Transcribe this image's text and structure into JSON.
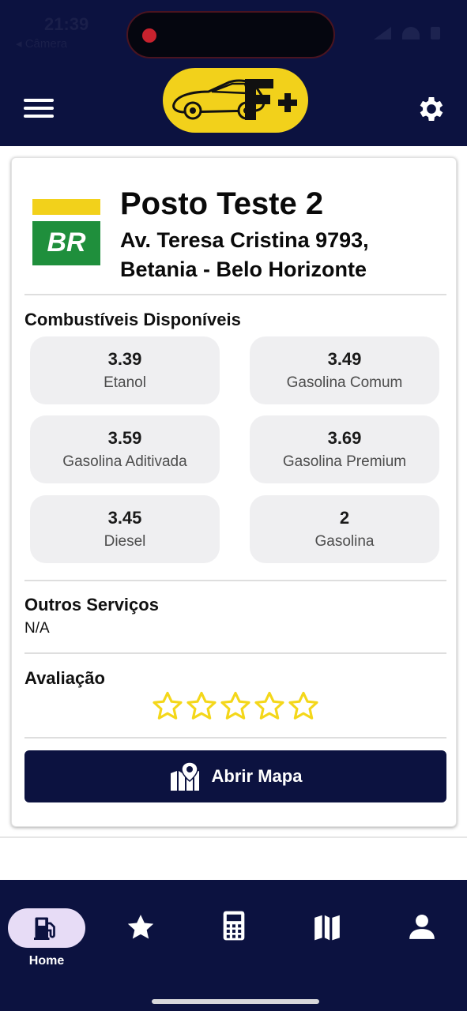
{
  "status_bar": {
    "time": "21:39",
    "back_label": "◂ Câmera"
  },
  "header": {
    "menu_icon": "hamburger-menu-icon",
    "logo_icon": "car-logo",
    "logo_text": "F+",
    "settings_icon": "gear-icon",
    "accent_color": "#f2d11b",
    "bar_color": "#0c1240"
  },
  "station": {
    "brand_logo_text": "BR",
    "name": "Posto Teste 2",
    "address": "Av. Teresa Cristina 9793, Betania - Belo Horizonte"
  },
  "fuels": {
    "title": "Combustíveis Disponíveis",
    "items": [
      {
        "price": "3.39",
        "name": "Etanol"
      },
      {
        "price": "3.49",
        "name": "Gasolina Comum"
      },
      {
        "price": "3.59",
        "name": "Gasolina Aditivada"
      },
      {
        "price": "3.69",
        "name": "Gasolina Premium"
      },
      {
        "price": "3.45",
        "name": "Diesel"
      },
      {
        "price": "2",
        "name": "Gasolina"
      }
    ]
  },
  "services": {
    "title": "Outros Serviços",
    "value": "N/A"
  },
  "rating": {
    "title": "Avaliação",
    "stars_filled": 0,
    "stars_total": 5,
    "star_color": "#f4d71a"
  },
  "map_button": {
    "label": "Abrir Mapa",
    "icon": "map-marker-icon"
  },
  "bottom_nav": {
    "items": [
      {
        "icon": "fuel-pump-icon",
        "label": "Home",
        "active": true
      },
      {
        "icon": "star-icon",
        "label": ""
      },
      {
        "icon": "calculator-icon",
        "label": ""
      },
      {
        "icon": "map-icon",
        "label": ""
      },
      {
        "icon": "user-icon",
        "label": ""
      }
    ]
  }
}
